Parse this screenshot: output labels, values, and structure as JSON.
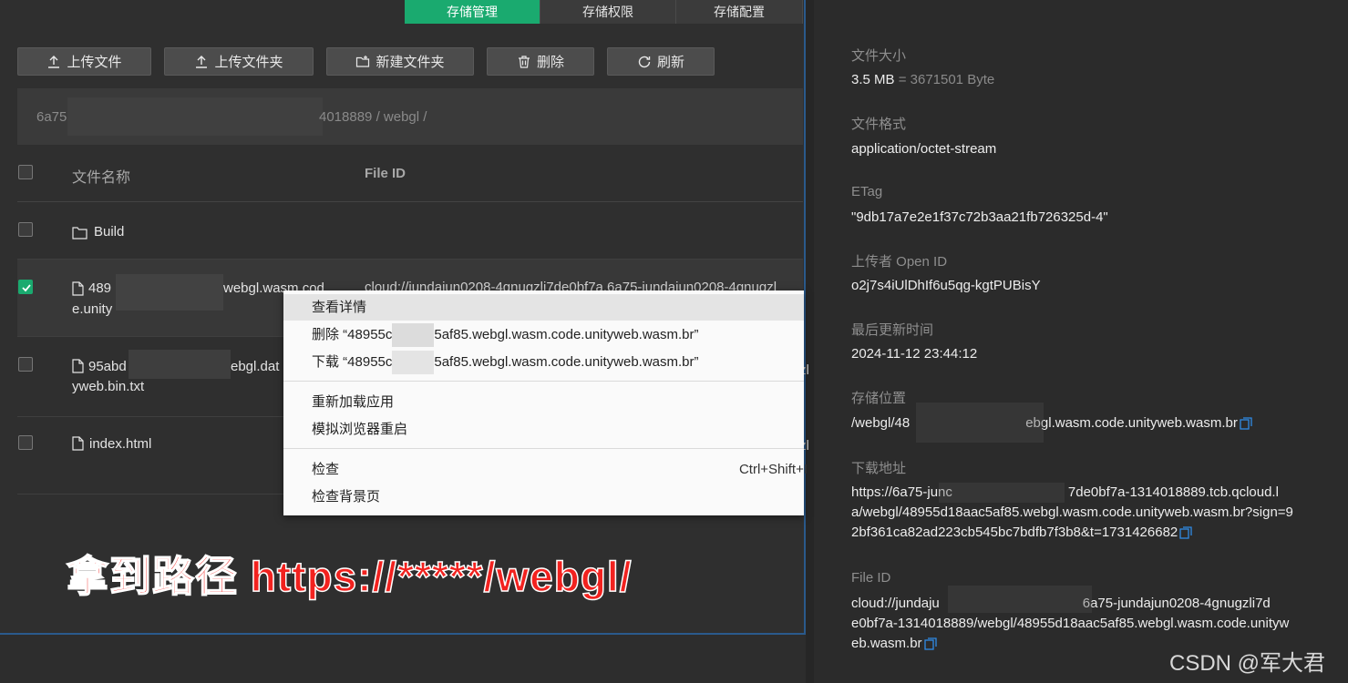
{
  "tabs": [
    "存储管理",
    "存储权限",
    "存储配置"
  ],
  "toolbar": {
    "upload_file": "上传文件",
    "upload_folder": "上传文件夹",
    "new_folder": "新建文件夹",
    "delete": "删除",
    "refresh": "刷新"
  },
  "breadcrumb": {
    "visible_prefix": "6a75",
    "visible_suffix": "4018889 / webgl /"
  },
  "table": {
    "col_name": "文件名称",
    "col_id": "File ID",
    "rows": [
      {
        "name_line1": "Build",
        "name_line2": "",
        "type": "folder",
        "checked": false,
        "file_id": ""
      },
      {
        "name_line1_start": "489",
        "name_line1_end": "webgl.wasm.cod",
        "name_line2": "e.unity",
        "type": "file",
        "checked": true,
        "file_id": "cloud://jundajun0208-4gnugzli7de0bf7a.6a75-jundajun0208-4gnugzl"
      },
      {
        "name_line1_start": "95abd",
        "name_line1_end": "ebgl.dat",
        "name_line2": "yweb.bin.txt",
        "type": "file",
        "checked": false,
        "file_id": "zl"
      },
      {
        "name_line1": "index.html",
        "name_line2": "",
        "type": "file",
        "checked": false,
        "file_id": "zl"
      }
    ]
  },
  "context_menu": {
    "view_details": "查看详情",
    "delete_prefix": "删除 “48955c",
    "delete_suffix": "5af85.webgl.wasm.code.unityweb.wasm.br”",
    "download_prefix": "下载 “48955c",
    "download_suffix": "5af85.webgl.wasm.code.unityweb.wasm.br”",
    "reload_app": "重新加载应用",
    "simulate_restart": "模拟浏览器重启",
    "inspect": "检查",
    "inspect_shortcut": "Ctrl+Shift+I",
    "inspect_background": "检查背景页"
  },
  "caption": "拿到路径 https://*****/webgl/",
  "details": {
    "size_label": "文件大小",
    "size_value": "3.5 MB",
    "size_bytes": "= 3671501 Byte",
    "format_label": "文件格式",
    "format_value": "application/octet-stream",
    "etag_label": "ETag",
    "etag_value": "\"9db17a7e2e1f37c72b3aa21fb726325d-4\"",
    "uploader_label": "上传者 Open ID",
    "uploader_value": "o2j7s4iUlDhIf6u5qg-kgtPUBisY",
    "updated_label": "最后更新时间",
    "updated_value": "2024-11-12 23:44:12",
    "location_label": "存储位置",
    "location_prefix": "/webgl/48",
    "location_suffix": "ebgl.wasm.code.unityweb.wasm.br",
    "download_label": "下载地址",
    "download_line1_prefix": "https://6a75-junc",
    "download_line1_suffix": "7de0bf7a-1314018889.tcb.qcloud.l",
    "download_line2": "a/webgl/48955d18aac5af85.webgl.wasm.code.unityweb.wasm.br?sign=9",
    "download_line3": "2bf361ca82ad223cb545bc7bdfb7f3b8&t=1731426682",
    "fileid_label": "File ID",
    "fileid_line1_prefix": "cloud://jundaju",
    "fileid_line1_suffix": "6a75-jundajun0208-4gnugzli7d",
    "fileid_line2": "e0bf7a-1314018889/webgl/48955d18aac5af85.webgl.wasm.code.unityw",
    "fileid_line3": "eb.wasm.br"
  },
  "watermark": "CSDN @军大君",
  "colors": {
    "accent": "#1aaa6f",
    "caption": "#f2221f",
    "link_icon": "#2f8be6"
  }
}
